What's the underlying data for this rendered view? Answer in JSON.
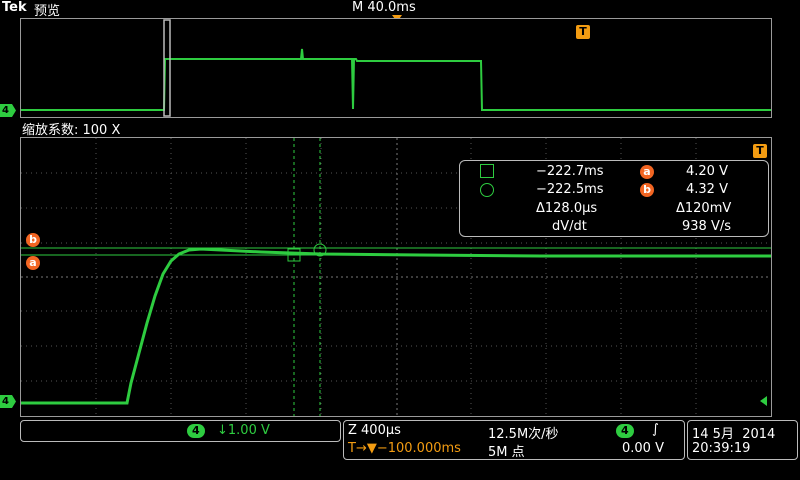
{
  "header": {
    "brand": "Tek",
    "mode": "预览",
    "timebase": "M 40.0ms"
  },
  "overview": {
    "trigger_marker": "T",
    "channel_marker": "4"
  },
  "zoom": {
    "label": "缩放系数: 100 X"
  },
  "main": {
    "trigger_marker": "T",
    "cursor_a_label": "a",
    "cursor_b_label": "b",
    "channel_marker": "4"
  },
  "readout": {
    "row1_left": "−222.7ms",
    "row1_badge": "a",
    "row1_right": "4.20 V",
    "row2_left": "−222.5ms",
    "row2_badge": "b",
    "row2_right": "4.32 V",
    "row3_left": "Δ128.0µs",
    "row3_right": "Δ120mV",
    "row4_left": "dV/dt",
    "row4_right": "938 V/s"
  },
  "status": {
    "channel": "4",
    "scale": "↓1.00 V",
    "zoom_time": "Z 400µs",
    "sample_rate": "12.5M次/秒",
    "trigger_channel": "4",
    "trigger_slope": "∫",
    "trigger_position": "T→▼−100.000ms",
    "record_length": "5M 点",
    "trigger_level": "0.00 V",
    "date": "14 5月  2014",
    "time": "20:39:19"
  },
  "colors": {
    "trace": "#2ecc40",
    "trigger": "#f39c12",
    "cursor_badge": "#f26522"
  }
}
